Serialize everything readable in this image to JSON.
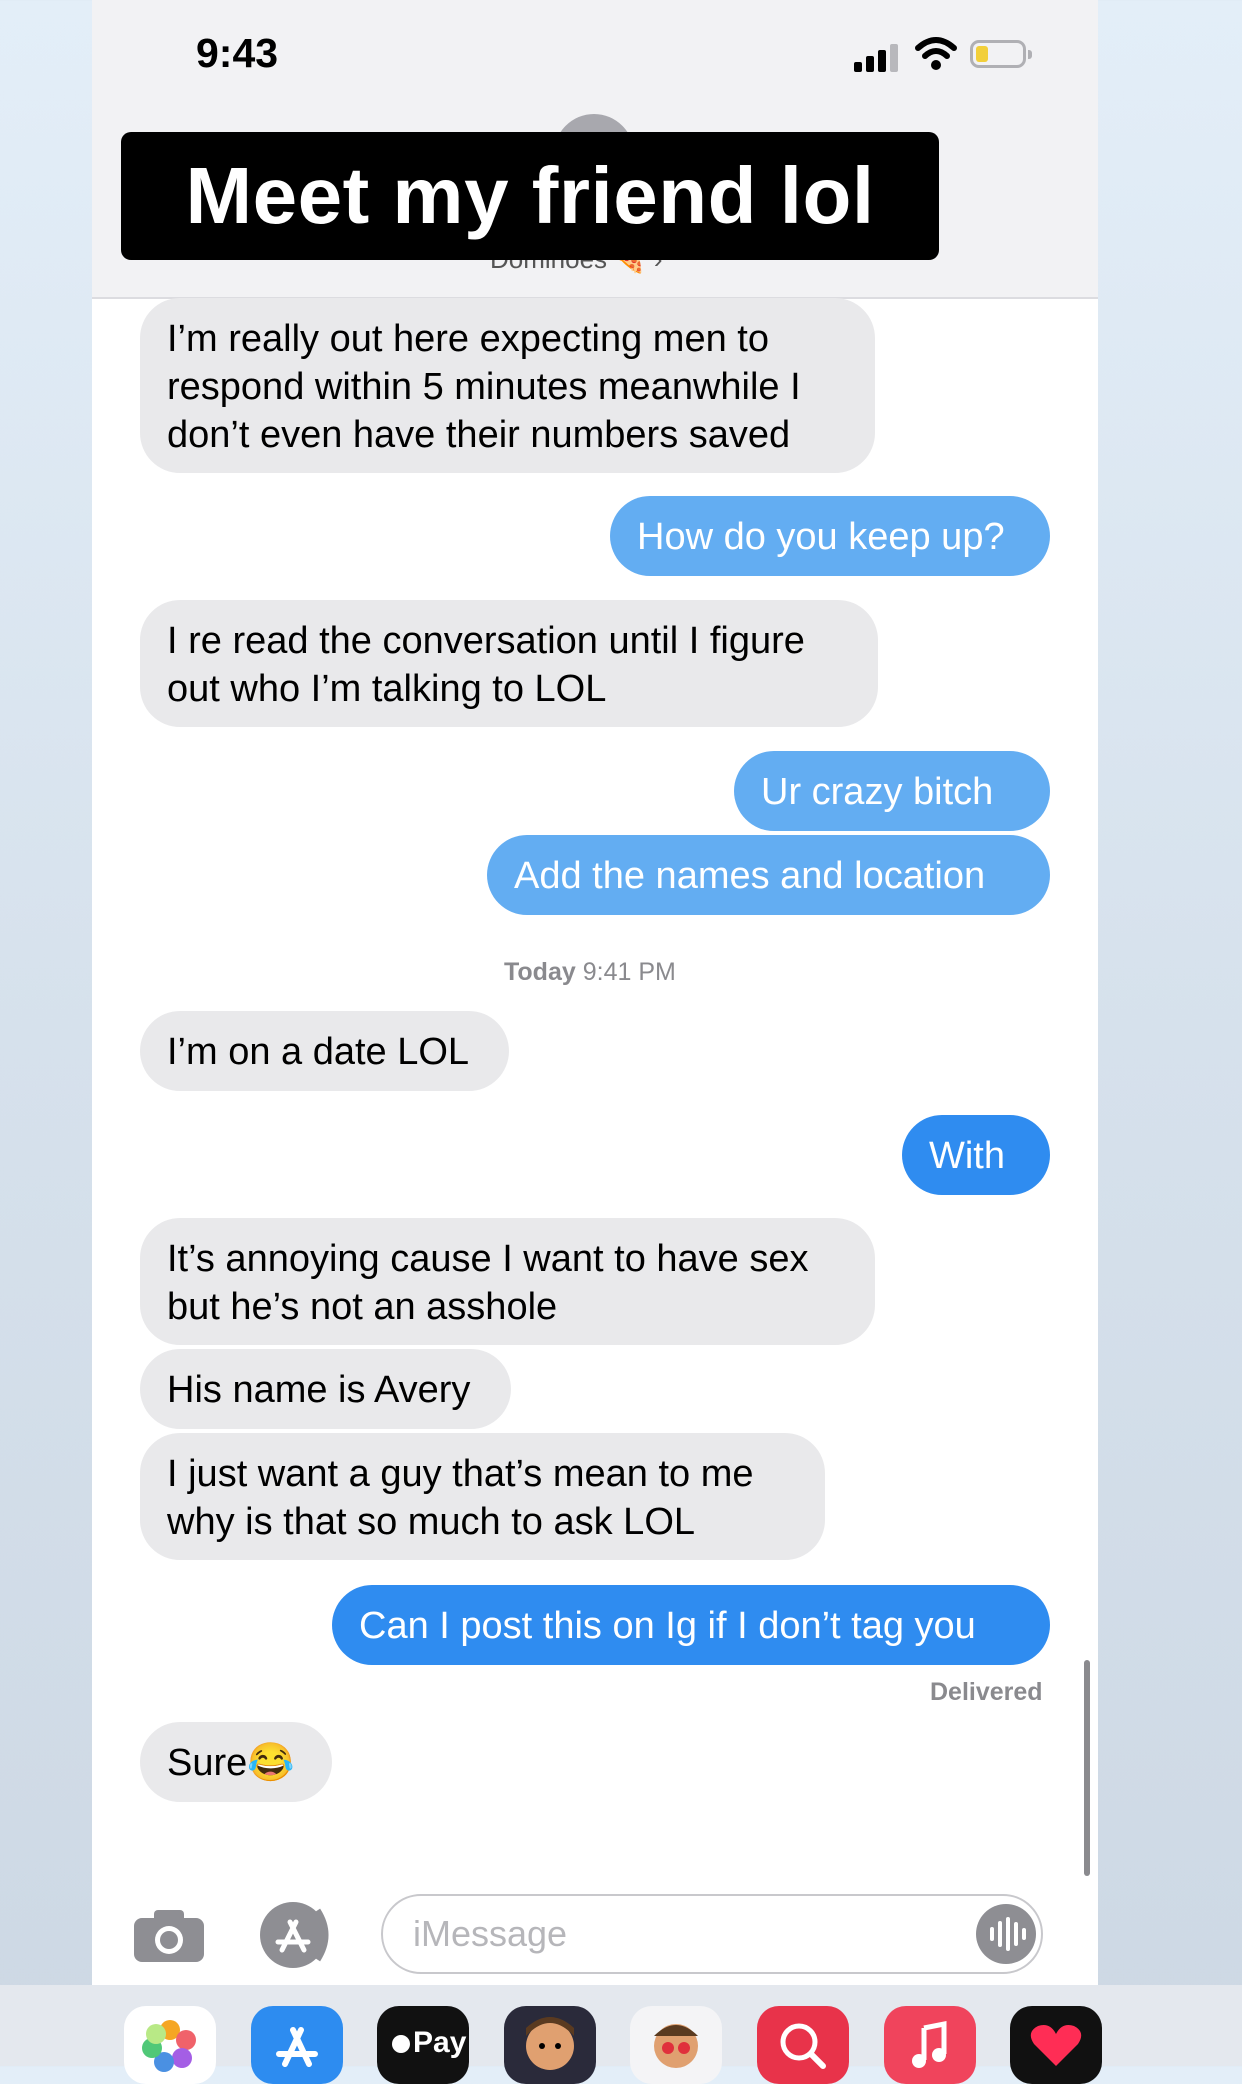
{
  "status_bar": {
    "time": "9:43"
  },
  "header": {
    "contact_name": "Dominoes 🍕 ›"
  },
  "overlay_caption": "Meet my friend lol",
  "messages": [
    {
      "side": "received",
      "lines": [
        "I’m really out here expecting men to",
        "respond within 5 minutes meanwhile I",
        "don’t even have their numbers saved"
      ]
    },
    {
      "side": "sent",
      "lines": [
        "How do you keep up?"
      ]
    },
    {
      "side": "received",
      "lines": [
        "I re read the conversation until I figure",
        "out who I’m talking to LOL"
      ]
    },
    {
      "side": "sent",
      "lines": [
        "Ur crazy bitch"
      ]
    },
    {
      "side": "sent",
      "lines": [
        "Add the names and location"
      ]
    },
    {
      "side": "received",
      "lines": [
        "I’m on a date LOL"
      ]
    },
    {
      "side": "sent",
      "lines": [
        "With"
      ]
    },
    {
      "side": "received",
      "lines": [
        "It’s annoying cause I want to have sex",
        "but he’s not an asshole"
      ]
    },
    {
      "side": "received",
      "lines": [
        "His name is Avery"
      ]
    },
    {
      "side": "received",
      "lines": [
        "I just want a guy that’s mean to me",
        "why is that so much to ask LOL"
      ]
    },
    {
      "side": "sent",
      "lines": [
        "Can I post this on Ig if I don’t tag you"
      ]
    },
    {
      "side": "received",
      "lines": [
        "Sure😂"
      ]
    }
  ],
  "timestamp": {
    "day": "Today",
    "time": "9:41 PM"
  },
  "delivered_label": "Delivered",
  "composer": {
    "placeholder": "iMessage"
  },
  "dock": {
    "apple_pay_label": "Pay"
  },
  "colors": {
    "sent_bubble": "#2f8cf0",
    "received_bubble": "#e9e9eb",
    "accent": "#2f7cf6"
  }
}
